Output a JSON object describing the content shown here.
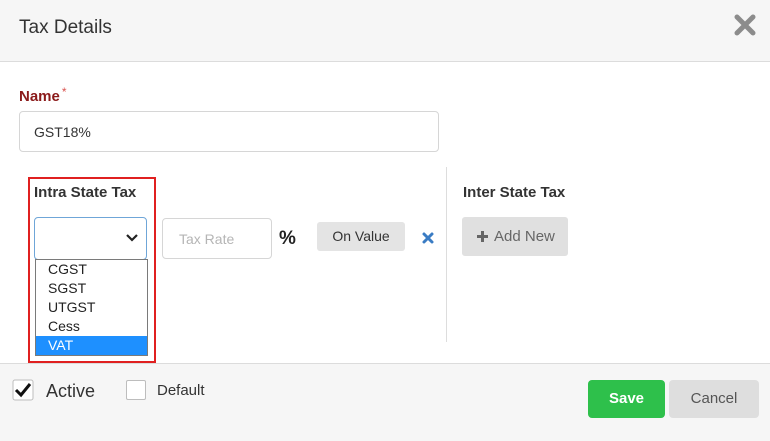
{
  "dialog": {
    "title": "Tax Details",
    "close_icon": "close-icon"
  },
  "name_field": {
    "label": "Name",
    "required_mark": "*",
    "value": "GST18%"
  },
  "intra_state": {
    "title": "Intra State Tax",
    "select_value": "",
    "options": [
      "CGST",
      "SGST",
      "UTGST",
      "Cess",
      "VAT"
    ],
    "highlighted_option": "VAT",
    "tax_rate_placeholder": "Tax Rate",
    "percent_symbol": "%",
    "on_value_label": "On Value",
    "remove_icon": "remove-x-icon"
  },
  "inter_state": {
    "title": "Inter State Tax",
    "add_new_label": "Add New",
    "add_icon": "plus-icon"
  },
  "footer": {
    "active_label": "Active",
    "active_checked": true,
    "default_label": "Default",
    "default_checked": false,
    "save_label": "Save",
    "cancel_label": "Cancel"
  },
  "colors": {
    "save_green": "#2ec04b",
    "label_red": "#8b1a1a",
    "highlight_blue": "#1e90ff",
    "remove_blue": "#3a7cc4",
    "highlight_box": "#e02020"
  }
}
